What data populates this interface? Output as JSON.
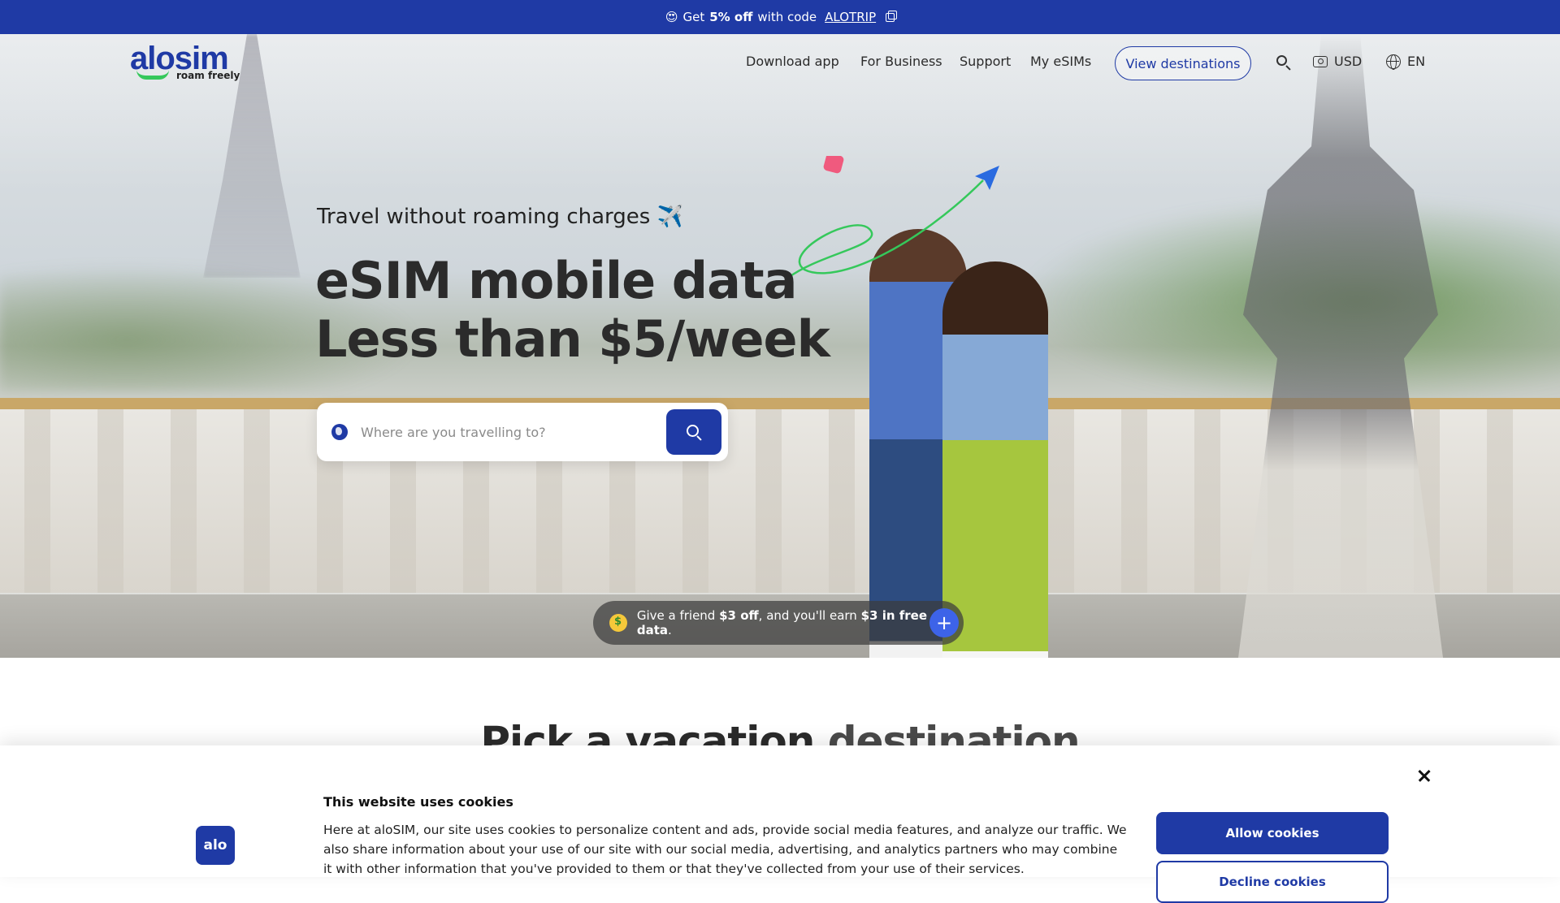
{
  "promo": {
    "emoji": "😍",
    "prefix": "Get",
    "discount": "5% off",
    "middle": "with code",
    "code": "ALOTRIP"
  },
  "brand": {
    "name": "alosim",
    "tagline": "roam freely",
    "colors": {
      "primary": "#1f3aa5",
      "accent_green": "#35c85b"
    }
  },
  "nav": {
    "links": [
      "Download app",
      "For Business",
      "Support",
      "My eSIMs"
    ],
    "cta": "View destinations",
    "currency": "USD",
    "language": "EN"
  },
  "hero": {
    "tagline": "Travel without roaming charges ✈️",
    "headline_line1": "eSIM mobile data",
    "headline_line2": "Less than $5/week",
    "search_placeholder": "Where are you travelling to?"
  },
  "referral": {
    "emoji": "🤑",
    "text_start": "Give a friend",
    "bold1": "$3 off",
    "text_mid": ", and you'll earn",
    "bold2": "$3 in free data",
    "text_end": "."
  },
  "section": {
    "title_part1": "Pick a vacation",
    "title_part2": "destination"
  },
  "cookie": {
    "logo_text": "alo",
    "title": "This website uses cookies",
    "body": "Here at aloSIM, our site uses cookies to personalize content and ads, provide social media features, and analyze our traffic. We also share information about your use of our site with our social media, advertising, and analytics partners who may combine it with other information that you've provided to them or that they've collected from your use of their services.",
    "allow": "Allow cookies",
    "decline": "Decline cookies"
  }
}
